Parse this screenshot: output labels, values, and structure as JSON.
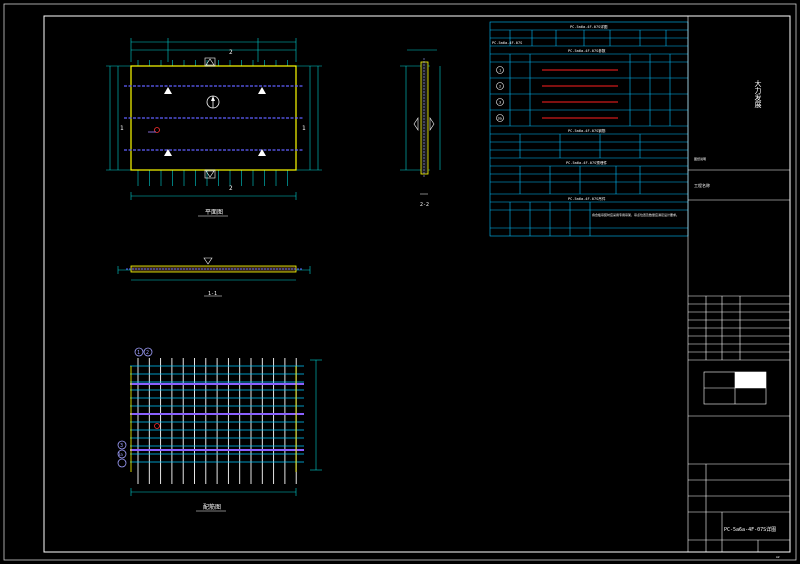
{
  "views": {
    "plan_title": "平面图",
    "section_11_title": "1-1",
    "section_22_title": "2-2",
    "rebar_title": "配筋图",
    "section_mark_1": "1",
    "section_mark_2": "2"
  },
  "tables": {
    "main_title": "PC-5a6a-4F-07S详图",
    "params_title": "PC-5a6a-4F-07S参数",
    "rebar_table_title": "PC-5a6a-4F-07S钢筋",
    "embed_table_title": "PC-5a6a-4F-07S预埋件",
    "lift_table_title": "PC-5a6a-4F-07S吊件",
    "note_table_title": "PC-5a6a-4F-07S说明",
    "main_row_label": "PC-5a6a-4F-07S",
    "bar_ids": [
      "1",
      "2",
      "3",
      "3a"
    ],
    "note_text": "叠合板吊装时应采用专用吊架，吊点位置及数量应满足设计要求。"
  },
  "titleblock": {
    "company": "大力发展",
    "project_row": "工程名称",
    "drawing_name": "PC-5a6a-4F-07S详图",
    "note_small": "图纸说明",
    "sheet": "A2"
  },
  "colors": {
    "background": "#000000",
    "frame": "#ffffff",
    "slab_outline": "#ffff00",
    "dimension": "#00d0d0",
    "rebar": "#6060ff",
    "table_line": "#00bfff",
    "highlight": "#ff2020"
  }
}
